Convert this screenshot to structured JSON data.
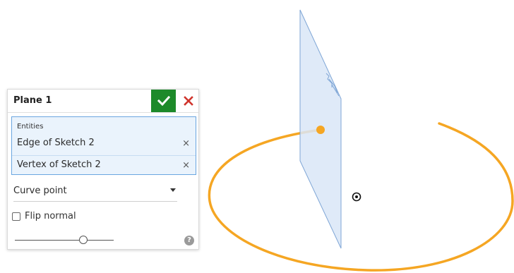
{
  "panel": {
    "title": "Plane 1",
    "accept_icon": "checkmark-icon",
    "cancel_icon": "close-icon",
    "entities_label": "Entities",
    "entities": [
      {
        "label": "Edge of Sketch 2",
        "remove_icon": "×"
      },
      {
        "label": "Vertex of Sketch 2",
        "remove_icon": "×"
      }
    ],
    "plane_type": "Curve point",
    "flip_normal_label": "Flip normal",
    "flip_normal_checked": false,
    "slider_fraction": 0.69,
    "help_icon": "?"
  },
  "colors": {
    "accept": "#1d8a2a",
    "cancel": "#d0342c",
    "selection_border": "#6aa6e0",
    "selection_fill": "#eaf3fc",
    "sketch_curve": "#f5a623",
    "plane_fill": "#d9e6f7",
    "plane_edge": "#7fa6d6"
  }
}
